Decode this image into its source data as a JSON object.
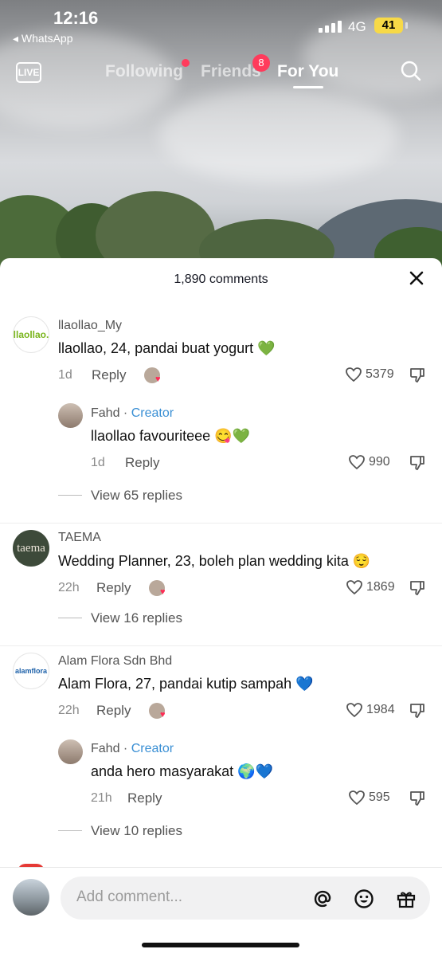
{
  "status_bar": {
    "time": "12:16",
    "back_app": "◂ WhatsApp",
    "network": "4G",
    "battery": "41"
  },
  "nav": {
    "live": "LIVE",
    "tabs": [
      "Following",
      "Friends",
      "For You"
    ],
    "friends_badge": "8",
    "active_tab": "For You"
  },
  "comments_sheet": {
    "title": "1,890 comments",
    "comments": [
      {
        "username": "llaollao_My",
        "avatar_text": "llaollao.",
        "text": "llaollao, 24, pandai buat yogurt 💚",
        "time": "1d",
        "reply": "Reply",
        "likes": "5379",
        "replies": [
          {
            "username": "Fahd",
            "creator_tag": "Creator",
            "text": "llaollao favouriteee 😋💚",
            "time": "1d",
            "reply": "Reply",
            "likes": "990"
          }
        ],
        "view_replies": "View 65 replies"
      },
      {
        "username": "TAEMA",
        "avatar_text": "taema",
        "text": "Wedding Planner, 23, boleh plan wedding kita 😌",
        "time": "22h",
        "reply": "Reply",
        "likes": "1869",
        "replies": [],
        "view_replies": "View 16 replies"
      },
      {
        "username": "Alam Flora Sdn Bhd",
        "avatar_text": "alamflora",
        "text": "Alam Flora, 27, pandai kutip sampah 💙",
        "time": "22h",
        "reply": "Reply",
        "likes": "1984",
        "replies": [
          {
            "username": "Fahd",
            "creator_tag": "Creator",
            "text": "anda hero masyarakat 🌍💙",
            "time": "21h",
            "reply": "Reply",
            "likes": "595"
          }
        ],
        "view_replies": "View 10 replies"
      }
    ]
  },
  "composer": {
    "placeholder": "Add comment...",
    "icons": [
      "at-icon",
      "emoji-icon",
      "gift-icon"
    ]
  },
  "colors": {
    "accent_red": "#fe2c55",
    "creator_blue": "#3a8fd4",
    "like_green": "#56b43c"
  }
}
